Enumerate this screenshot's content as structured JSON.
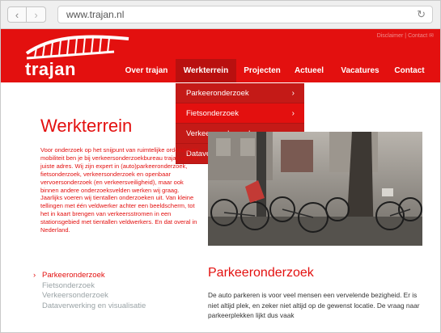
{
  "browser": {
    "url": "www.trajan.nl",
    "back_icon": "chevron-left-icon",
    "forward_icon": "chevron-right-icon",
    "reload_icon": "reload-icon"
  },
  "brand": {
    "logo_text": "trajan",
    "color": "#e3100f"
  },
  "header": {
    "top_links": "Disclaimer | Contact ✉"
  },
  "nav": {
    "items": [
      {
        "label": "Over trajan"
      },
      {
        "label": "Werkterrein",
        "active": true
      },
      {
        "label": "Projecten"
      },
      {
        "label": "Actueel"
      },
      {
        "label": "Vacatures"
      },
      {
        "label": "Contact"
      }
    ]
  },
  "dropdown": {
    "items": [
      {
        "label": "Parkeeronderzoek"
      },
      {
        "label": "Fietsonderzoek",
        "hover": true
      },
      {
        "label": "Verkeersonderzoek"
      },
      {
        "label": "Dataverwerking en visualisatie"
      }
    ],
    "arrow": "›"
  },
  "main": {
    "title": "Werkterrein",
    "intro": "Voor onderzoek op het snijpunt van ruimtelijke ordening en mobiliteit ben je bij verkeersonderzoekbureau trajan op het juiste adres. Wij zijn expert in (auto)parkeeronderzoek, fietsonderzoek, verkeersonderzoek en openbaar vervoersonderzoek (en verkeersveiligheid), maar ook binnen andere onderzoeksvelden werken wij graag. Jaarlijks voeren wij tientallen onderzoeken uit. Van kleine tellingen met één veldwerker achter een beeldscherm, tot het in kaart brengen van verkeersstromen in een stationsgebied met tientallen veldwerkers. En dat overal in Nederland.",
    "subnav": [
      {
        "label": "Parkeeronderzoek",
        "active": true
      },
      {
        "label": "Fietsonderzoek"
      },
      {
        "label": "Verkeersonderzoek"
      },
      {
        "label": "Dataverwerking en visualisatie"
      }
    ],
    "subnav_chevron": "›",
    "section_title": "Parkeeronderzoek",
    "section_body": "De auto parkeren is voor veel mensen een vervelende bezigheid. Er is niet altijd plek, en zeker niet altijd op de gewenst locatie. De vraag naar parkeerplekken lijkt dus vaak"
  }
}
